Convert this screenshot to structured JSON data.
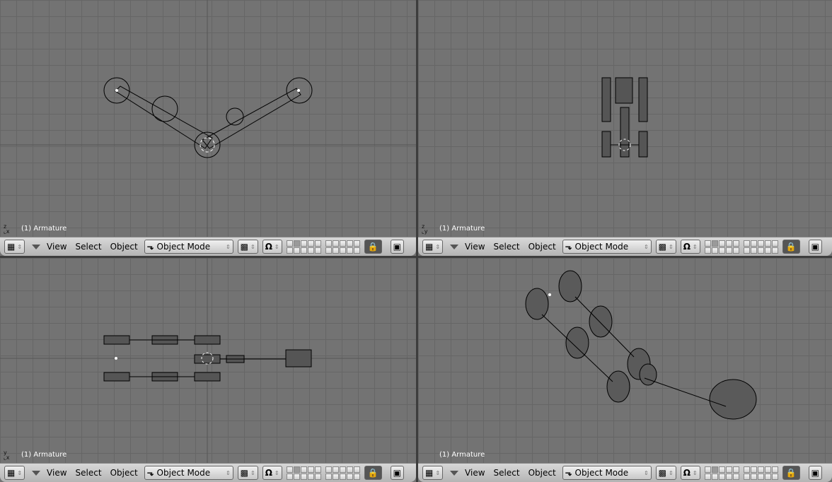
{
  "viewports": [
    {
      "id": "front",
      "label": "(1) Armature",
      "axes": [
        "z",
        "x"
      ]
    },
    {
      "id": "side",
      "label": "(1) Armature",
      "axes": [
        "z",
        "y"
      ]
    },
    {
      "id": "top",
      "label": "(1) Armature",
      "axes": [
        "y",
        "x"
      ]
    },
    {
      "id": "camera",
      "label": "(1) Armature",
      "axes": []
    }
  ],
  "header": {
    "menus": [
      "View",
      "Select",
      "Object"
    ],
    "mode": "Object Mode",
    "icons": [
      "grid-icon",
      "armature-icon",
      "draw-type-icon",
      "pivot-icon",
      "lock-icon",
      "render-icon"
    ]
  },
  "colors": {
    "bg": "#737373",
    "grid": "#666666",
    "header": "#c8c8c8"
  }
}
